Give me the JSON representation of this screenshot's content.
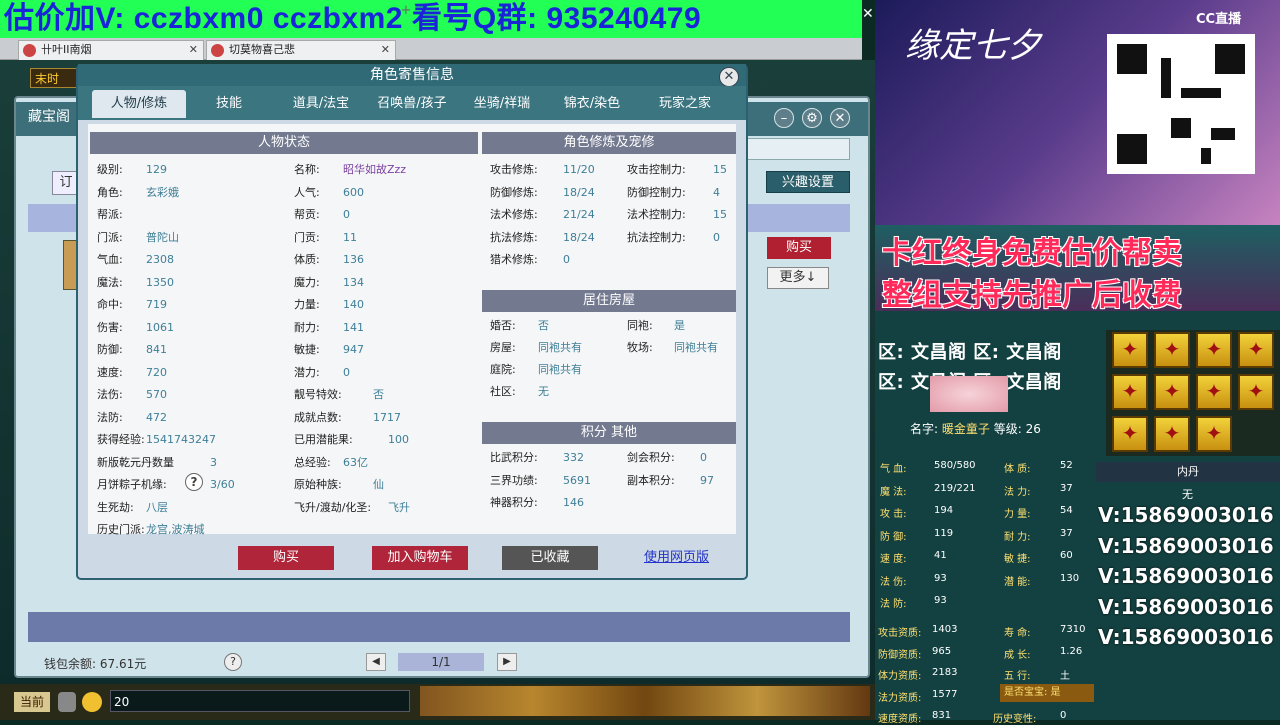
{
  "banner": {
    "text": "估价加V:   cczbxm0   cczbxm2   看号Q群: 935240479"
  },
  "browser_tabs": [
    {
      "label": "卄叶II南烟"
    },
    {
      "label": "切莫物喜己悲"
    }
  ],
  "game_window": {
    "title": "藏宝阁",
    "top_label": "末时",
    "order_label": "订",
    "interest_label": "兴趣设置",
    "buy_label": "购买",
    "more_label": "更多↓",
    "wallet": "钱包余额: 67.61元",
    "page": "1/1",
    "chat_channel": "当前",
    "chat_text": "20"
  },
  "dialog": {
    "title": "角色寄售信息",
    "tabs": [
      "人物/修炼",
      "技能",
      "道具/法宝",
      "召唤兽/孩子",
      "坐骑/祥瑞",
      "锦衣/染色",
      "玩家之家"
    ],
    "status": {
      "heading": "人物状态",
      "col1": [
        {
          "k": "级别:",
          "v": "129"
        },
        {
          "k": "角色:",
          "v": "玄彩娥"
        },
        {
          "k": "帮派:",
          "v": ""
        },
        {
          "k": "门派:",
          "v": "普陀山"
        },
        {
          "k": "气血:",
          "v": "2308"
        },
        {
          "k": "魔法:",
          "v": "1350"
        },
        {
          "k": "命中:",
          "v": "719"
        },
        {
          "k": "伤害:",
          "v": "1061"
        },
        {
          "k": "防御:",
          "v": "841"
        },
        {
          "k": "速度:",
          "v": "720"
        },
        {
          "k": "法伤:",
          "v": "570"
        },
        {
          "k": "法防:",
          "v": "472"
        },
        {
          "k": "获得经验:",
          "v": "1541743247"
        },
        {
          "k": "新版乾元丹数量",
          "v": "3"
        },
        {
          "k": "月饼粽子机缘:",
          "v": "3/60"
        },
        {
          "k": "生死劫:",
          "v": "八层"
        },
        {
          "k": "历史门派:",
          "v": "龙宫,波涛城"
        }
      ],
      "col2": [
        {
          "k": "名称:",
          "v": "昭华如故Zzz"
        },
        {
          "k": "人气:",
          "v": "600"
        },
        {
          "k": "帮贡:",
          "v": "0"
        },
        {
          "k": "门贡:",
          "v": "11"
        },
        {
          "k": "体质:",
          "v": "136"
        },
        {
          "k": "魔力:",
          "v": "134"
        },
        {
          "k": "力量:",
          "v": "140"
        },
        {
          "k": "耐力:",
          "v": "141"
        },
        {
          "k": "敏捷:",
          "v": "947"
        },
        {
          "k": "潜力:",
          "v": "0"
        },
        {
          "k": "靓号特效:",
          "v": "否"
        },
        {
          "k": "成就点数:",
          "v": "1717"
        },
        {
          "k": "已用潜能果:",
          "v": "100"
        },
        {
          "k": "总经验:",
          "v": "63亿"
        },
        {
          "k": "原始种族:",
          "v": "仙"
        },
        {
          "k": "飞升/渡劫/化圣:",
          "v": "飞升"
        }
      ]
    },
    "cultivation": {
      "heading": "角色修炼及宠修",
      "left": [
        {
          "k": "攻击修炼:",
          "v": "11/20"
        },
        {
          "k": "防御修炼:",
          "v": "18/24"
        },
        {
          "k": "法术修炼:",
          "v": "21/24"
        },
        {
          "k": "抗法修炼:",
          "v": "18/24"
        },
        {
          "k": "猎术修炼:",
          "v": "0"
        }
      ],
      "right": [
        {
          "k": "攻击控制力:",
          "v": "15"
        },
        {
          "k": "防御控制力:",
          "v": "4"
        },
        {
          "k": "法术控制力:",
          "v": "15"
        },
        {
          "k": "抗法控制力:",
          "v": "0"
        }
      ]
    },
    "house": {
      "heading": "居住房屋",
      "rows": [
        {
          "k": "婚否:",
          "v": "否",
          "k2": "同袍:",
          "v2": "是"
        },
        {
          "k": "房屋:",
          "v": "同袍共有",
          "k2": "牧场:",
          "v2": "同袍共有"
        },
        {
          "k": "庭院:",
          "v": "同袍共有",
          "k2": "",
          "v2": ""
        },
        {
          "k": "社区:",
          "v": "无",
          "k2": "",
          "v2": ""
        }
      ]
    },
    "points": {
      "heading": "积分 其他",
      "rows": [
        {
          "k": "比武积分:",
          "v": "332",
          "k2": "剑会积分:",
          "v2": "0"
        },
        {
          "k": "三界功绩:",
          "v": "5691",
          "k2": "副本积分:",
          "v2": "97"
        },
        {
          "k": "神器积分:",
          "v": "146",
          "k2": "",
          "v2": ""
        }
      ]
    },
    "buttons": {
      "buy": "购买",
      "cart": "加入购物车",
      "fav": "已收藏",
      "web": "使用网页版"
    }
  },
  "stream": {
    "ad_title": "缘定七夕",
    "cc_logo": "CC直播",
    "promo1": "卡红终身免费估价帮卖",
    "promo2": "整组支持先推广后收费",
    "zone1": "区: 文昌阁 区: 文昌阁",
    "zone2": "区: 文昌阁 区: 文昌阁",
    "char_name_label": "名字:",
    "char_name": "暖金童子",
    "char_level_label": "等级:",
    "char_level": "26",
    "neidan": "内丹",
    "neidan_none": "无",
    "stats_left": [
      {
        "k": "气  血:",
        "v": "580/580"
      },
      {
        "k": "魔  法:",
        "v": "219/221"
      },
      {
        "k": "攻  击:",
        "v": "194"
      },
      {
        "k": "防  御:",
        "v": "119"
      },
      {
        "k": "速  度:",
        "v": "41"
      },
      {
        "k": "法  伤:",
        "v": "93"
      },
      {
        "k": "法  防:",
        "v": "93"
      }
    ],
    "stats_right": [
      {
        "k": "体  质:",
        "v": "52"
      },
      {
        "k": "法  力:",
        "v": "37"
      },
      {
        "k": "力  量:",
        "v": "54"
      },
      {
        "k": "耐  力:",
        "v": "37"
      },
      {
        "k": "敏  捷:",
        "v": "60"
      },
      {
        "k": "潜  能:",
        "v": "130"
      }
    ],
    "aptitude_left": [
      {
        "k": "攻击资质:",
        "v": "1403"
      },
      {
        "k": "防御资质:",
        "v": "965"
      },
      {
        "k": "体力资质:",
        "v": "2183"
      },
      {
        "k": "法力资质:",
        "v": "1577"
      },
      {
        "k": "速度资质:",
        "v": "831"
      }
    ],
    "aptitude_right": [
      {
        "k": "寿  命:",
        "v": "7310"
      },
      {
        "k": "成  长:",
        "v": "1.26"
      },
      {
        "k": "五  行:",
        "v": "土"
      }
    ],
    "is_baby": "是否宝宝: 是",
    "history_label": "历史变性:",
    "history_val": "0",
    "contact": [
      "V:15869003016",
      "V:15869003016",
      "V:15869003016",
      "V:15869003016",
      "V:15869003016"
    ]
  }
}
